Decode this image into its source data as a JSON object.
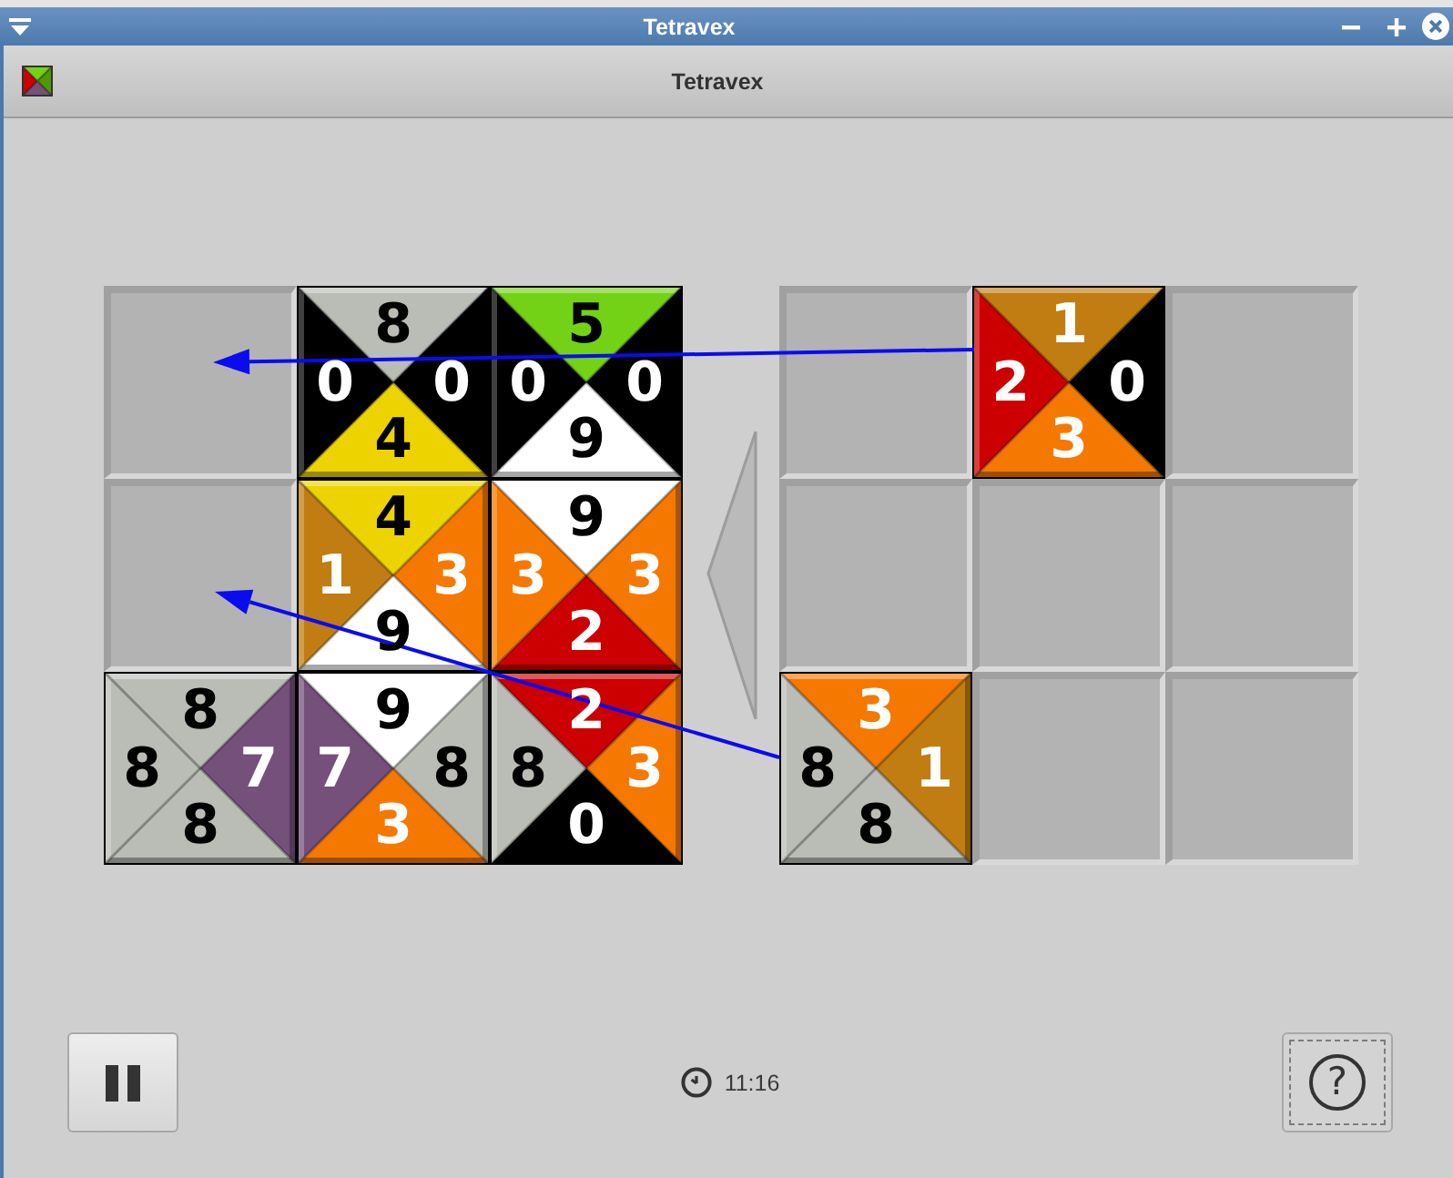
{
  "window": {
    "title": "Tetravex"
  },
  "header": {
    "title": "Tetravex"
  },
  "boards": [
    {
      "rows": [
        [
          {
            "kind": "empty"
          },
          {
            "kind": "tile",
            "top": {
              "number": "8",
              "color": "#babdb6"
            },
            "right": {
              "number": "0",
              "color": "#000000"
            },
            "bottom": {
              "number": "4",
              "color": "#edd400"
            },
            "left": {
              "number": "0",
              "color": "#000000"
            }
          },
          {
            "kind": "tile",
            "top": {
              "number": "5",
              "color": "#73d216"
            },
            "right": {
              "number": "0",
              "color": "#000000"
            },
            "bottom": {
              "number": "9",
              "color": "#ffffff"
            },
            "left": {
              "number": "0",
              "color": "#000000"
            }
          }
        ],
        [
          {
            "kind": "empty"
          },
          {
            "kind": "tile",
            "top": {
              "number": "4",
              "color": "#edd400"
            },
            "right": {
              "number": "3",
              "color": "#f57900"
            },
            "bottom": {
              "number": "9",
              "color": "#ffffff"
            },
            "left": {
              "number": "1",
              "color": "#c17d11"
            }
          },
          {
            "kind": "tile",
            "top": {
              "number": "9",
              "color": "#ffffff"
            },
            "right": {
              "number": "3",
              "color": "#f57900"
            },
            "bottom": {
              "number": "2",
              "color": "#cc0000"
            },
            "left": {
              "number": "3",
              "color": "#f57900"
            }
          }
        ],
        [
          {
            "kind": "tile",
            "top": {
              "number": "8",
              "color": "#babdb6"
            },
            "right": {
              "number": "7",
              "color": "#75507b"
            },
            "bottom": {
              "number": "8",
              "color": "#babdb6"
            },
            "left": {
              "number": "8",
              "color": "#babdb6"
            }
          },
          {
            "kind": "tile",
            "top": {
              "number": "9",
              "color": "#ffffff"
            },
            "right": {
              "number": "8",
              "color": "#babdb6"
            },
            "bottom": {
              "number": "3",
              "color": "#f57900"
            },
            "left": {
              "number": "7",
              "color": "#75507b"
            }
          },
          {
            "kind": "tile",
            "top": {
              "number": "2",
              "color": "#cc0000"
            },
            "right": {
              "number": "3",
              "color": "#f57900"
            },
            "bottom": {
              "number": "0",
              "color": "#000000"
            },
            "left": {
              "number": "8",
              "color": "#babdb6"
            }
          }
        ]
      ]
    },
    {
      "rows": [
        [
          {
            "kind": "empty"
          },
          {
            "kind": "tile",
            "top": {
              "number": "1",
              "color": "#c17d11"
            },
            "right": {
              "number": "0",
              "color": "#000000"
            },
            "bottom": {
              "number": "3",
              "color": "#f57900"
            },
            "left": {
              "number": "2",
              "color": "#cc0000"
            }
          },
          {
            "kind": "empty"
          }
        ],
        [
          {
            "kind": "empty"
          },
          {
            "kind": "empty"
          },
          {
            "kind": "empty"
          }
        ],
        [
          {
            "kind": "tile",
            "top": {
              "number": "3",
              "color": "#f57900"
            },
            "right": {
              "number": "1",
              "color": "#c17d11"
            },
            "bottom": {
              "number": "8",
              "color": "#babdb6"
            },
            "left": {
              "number": "8",
              "color": "#babdb6"
            }
          },
          {
            "kind": "empty"
          },
          {
            "kind": "empty"
          }
        ]
      ]
    }
  ],
  "footer": {
    "pause_button": {
      "focused": false
    },
    "time": "11:16",
    "help_button": {
      "symbol": "?",
      "focused": true
    }
  }
}
